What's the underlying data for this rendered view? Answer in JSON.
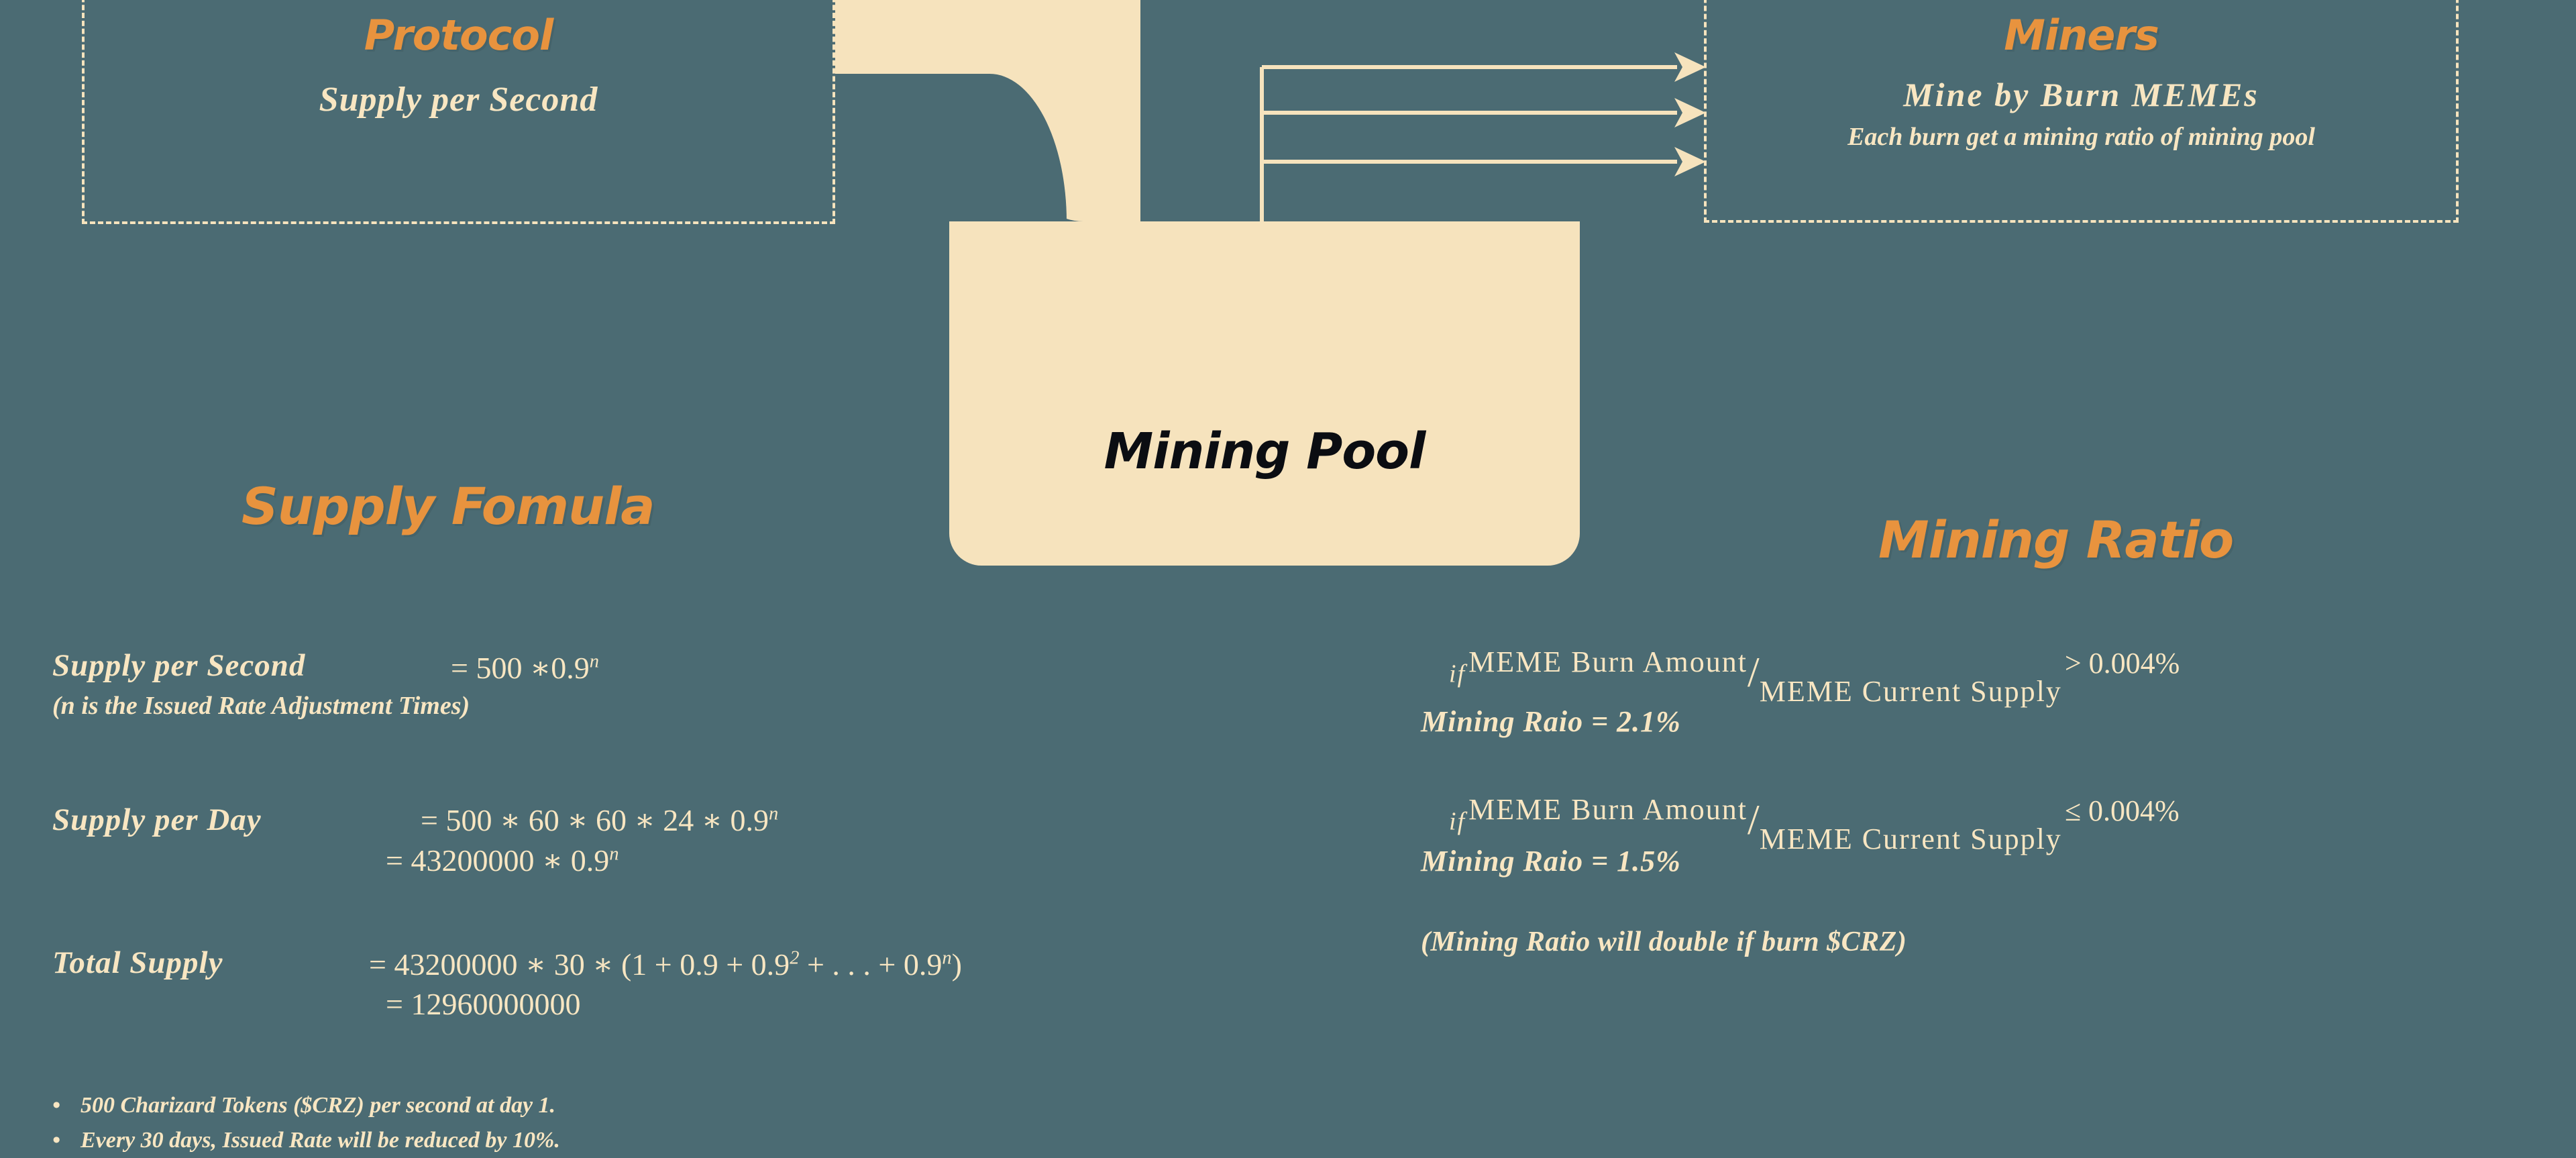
{
  "colors": {
    "background": "#4b6b73",
    "cream": "#f6e3bd",
    "text_cream": "#f8e6c2",
    "accent_orange": "#e8933e",
    "pool_label": "#0b0d12"
  },
  "protocol": {
    "title": "Protocol",
    "subtitle": "Supply per Second"
  },
  "miners": {
    "title": "Miners",
    "subtitle": "Mine by Burn MEMEs",
    "note": "Each burn get a mining ratio of mining pool"
  },
  "pool": {
    "label": "Mining Pool"
  },
  "supply_formula": {
    "title": "Supply Fomula",
    "per_second": {
      "label": "Supply per Second",
      "equals": "= 500",
      "operator": "∗",
      "base": "0.9",
      "exponent": "n",
      "note": "(n is the Issued Rate Adjustment Times)"
    },
    "per_day": {
      "label": "Supply per Day",
      "line1": "=  500  ∗  60  ∗  60  ∗  24  ∗  0.9",
      "line1_exp": "n",
      "line2": "=  43200000  ∗  0.9",
      "line2_exp": "n"
    },
    "total_supply": {
      "label": "Total Supply",
      "line1_a": "=  43200000  ∗  30 ∗ (1  +  0.9  +  0.9",
      "line1_exp1": "2",
      "line1_b": "  + . . . + 0.9",
      "line1_exp2": "n",
      "line1_c": ")",
      "line2": "= 12960000000"
    },
    "bullets": [
      "500 Charizard Tokens ($CRZ) per second at day 1.",
      "Every 30 days, Issued Rate will be reduced by 10%."
    ]
  },
  "mining_ratio": {
    "title": "Mining Ratio",
    "condition1": {
      "if": "if",
      "numerator": "MEME Burn Amount",
      "slash": "/",
      "denominator": "MEME Current Supply",
      "comparator": "> 0.004%",
      "result": "Mining Raio = 2.1%"
    },
    "condition2": {
      "if": "if",
      "numerator": "MEME Burn Amount",
      "slash": "/",
      "denominator": "MEME Current Supply",
      "comparator": "≤ 0.004%",
      "result": "Mining Raio = 1.5%"
    },
    "note": "(Mining Ratio will double if burn $CRZ)"
  }
}
